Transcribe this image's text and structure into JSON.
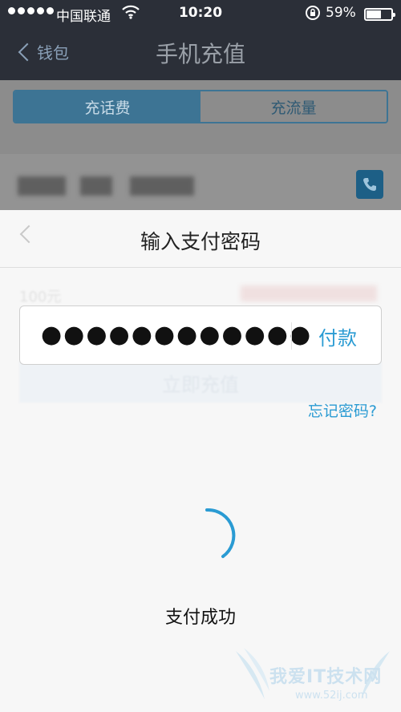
{
  "status_bar": {
    "carrier": "中国联通",
    "time": "10:20",
    "battery_percent": "59%",
    "battery_level": 0.59
  },
  "nav": {
    "back_label": "钱包",
    "title": "手机充值"
  },
  "tabs": [
    {
      "label": "充话费",
      "active": true
    },
    {
      "label": "充流量",
      "active": false
    }
  ],
  "sheet": {
    "title": "输入支付密码",
    "password_mask": "●●●●●●●●●●●●",
    "pay_label": "付款",
    "forgot_label": "忘记密码?",
    "status_text": "支付成功"
  },
  "background_page": {
    "amount_label": "100元",
    "recharge_label": "立即充值"
  },
  "watermark": {
    "text": "我爱IT技术网",
    "url": "www.52ij.com"
  },
  "colors": {
    "accent": "#2a9bd3",
    "topbar": "#2b2f38",
    "sheet_bg": "#f7f7f7"
  },
  "icons": {
    "signal": "signal-dots-icon",
    "wifi": "wifi-icon",
    "lock": "rotation-lock-icon",
    "battery": "battery-icon",
    "back": "chevron-left-icon",
    "contacts": "phone-book-icon",
    "loading": "spinner-icon"
  }
}
